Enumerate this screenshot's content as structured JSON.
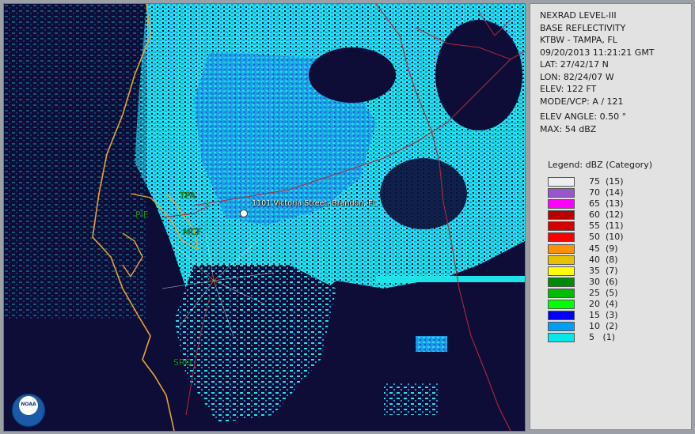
{
  "info": {
    "lines": [
      "NEXRAD LEVEL-III",
      "BASE REFLECTIVITY",
      "KTBW - TAMPA, FL",
      "09/20/2013 11:21:21 GMT",
      "LAT: 27/42/17 N",
      "LON: 82/24/07 W",
      "ELEV: 122 FT",
      "MODE/VCP: A / 121"
    ],
    "elev_angle": "ELEV ANGLE: 0.50 °",
    "max": "MAX: 54 dBZ"
  },
  "legend": {
    "title": "Legend: dBZ (Category)",
    "items": [
      {
        "label": "75  (15)",
        "color": "#eeeeee"
      },
      {
        "label": "70  (14)",
        "color": "#9955c9"
      },
      {
        "label": "65  (13)",
        "color": "#ff00ff"
      },
      {
        "label": "60  (12)",
        "color": "#b80000"
      },
      {
        "label": "55  (11)",
        "color": "#d40000"
      },
      {
        "label": "50  (10)",
        "color": "#ff0000"
      },
      {
        "label": "45  (9)",
        "color": "#ff9000"
      },
      {
        "label": "40  (8)",
        "color": "#e7c000"
      },
      {
        "label": "35  (7)",
        "color": "#ffff00"
      },
      {
        "label": "30  (6)",
        "color": "#008b00"
      },
      {
        "label": "25  (5)",
        "color": "#00bb00"
      },
      {
        "label": "20  (4)",
        "color": "#00ff00"
      },
      {
        "label": "15  (3)",
        "color": "#0000f6"
      },
      {
        "label": "10  (2)",
        "color": "#019ff4"
      },
      {
        "label": "5   (1)",
        "color": "#04e9e7"
      }
    ]
  },
  "map": {
    "location_label": "1101 Victoria Street, Brandon, FL",
    "station_labels": [
      "TPA",
      "PIE",
      "MCF",
      "SRQ"
    ],
    "logo_text": "NOAA",
    "colors": {
      "background": "#0d0d38",
      "coastline": "#e8a33a",
      "roads": "#b0283a",
      "echo_light": "#1ee3e8",
      "echo_mid": "#1c9cf0",
      "echo_dark": "#1f3fe0"
    }
  }
}
